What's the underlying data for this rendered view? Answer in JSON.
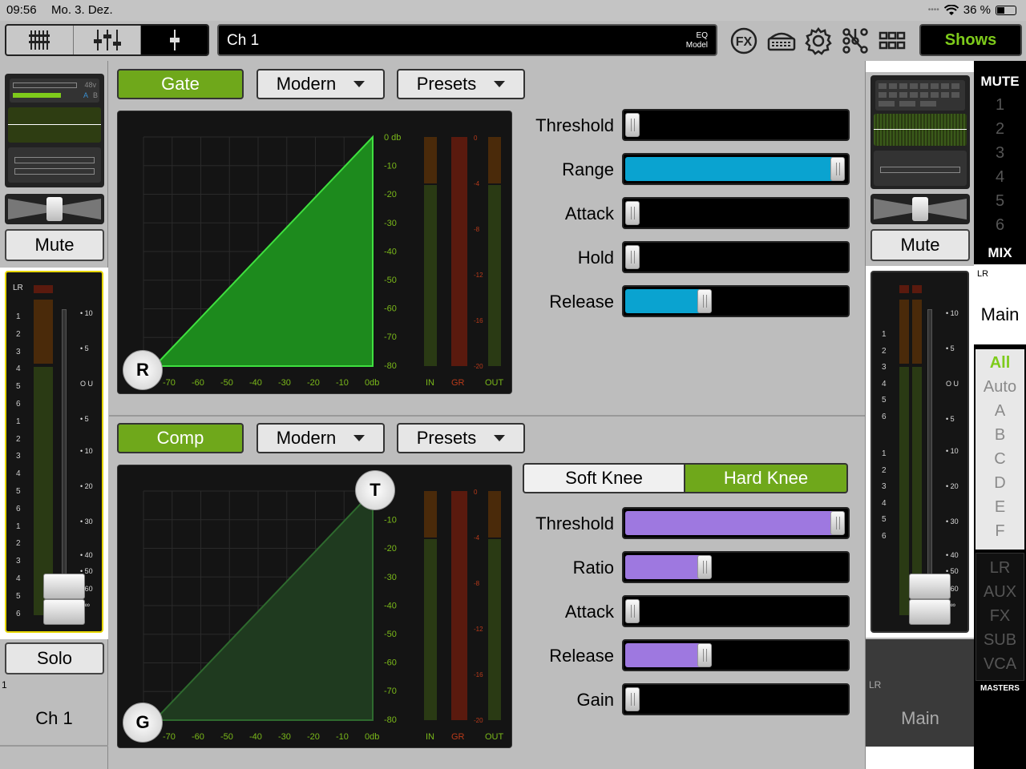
{
  "status": {
    "time": "09:56",
    "date": "Mo. 3. Dez.",
    "battery": "36 %",
    "battery_level": 0.36
  },
  "toolbar": {
    "channel_name": "Ch 1",
    "eq_label_1": "EQ",
    "eq_label_2": "Model",
    "fx_label": "FX",
    "shows_label": "Shows"
  },
  "left_strip": {
    "phantom": "48v",
    "ab_a": "A",
    "ab_b": "B",
    "mute_label": "Mute",
    "meter_lr": "LR",
    "solo_label": "Solo",
    "channel_number": "1",
    "channel_name": "Ch 1",
    "fader_scale": [
      "10",
      "5",
      "U",
      "5",
      "10",
      "20",
      "30",
      "40",
      "50",
      "60",
      "∞"
    ],
    "meter_rows": [
      "1",
      "2",
      "3",
      "4",
      "5",
      "6",
      "1",
      "2",
      "3",
      "4",
      "5",
      "6",
      "1",
      "2",
      "3",
      "4",
      "5",
      "6"
    ]
  },
  "gate": {
    "enable_label": "Gate",
    "model_label": "Modern",
    "presets_label": "Presets",
    "point_label": "R",
    "db_scale_y": [
      "0 db",
      "-10",
      "-20",
      "-30",
      "-40",
      "-50",
      "-60",
      "-70",
      "-80"
    ],
    "db_scale_x": [
      "-70",
      "-60",
      "-50",
      "-40",
      "-30",
      "-20",
      "-10",
      "0db"
    ],
    "meter_scale": [
      "0",
      "-4",
      "-8",
      "-12",
      "-16",
      "-20"
    ],
    "meter_in": "IN",
    "meter_gr": "GR",
    "meter_out": "OUT",
    "params": [
      {
        "label": "Threshold",
        "value": 0.0
      },
      {
        "label": "Range",
        "value": 1.0
      },
      {
        "label": "Attack",
        "value": 0.0
      },
      {
        "label": "Hold",
        "value": 0.0
      },
      {
        "label": "Release",
        "value": 0.35
      }
    ],
    "color": "#0aa3d0"
  },
  "comp": {
    "enable_label": "Comp",
    "model_label": "Modern",
    "presets_label": "Presets",
    "point_t_label": "T",
    "point_g_label": "G",
    "db_scale_y": [
      "db",
      "-10",
      "-20",
      "-30",
      "-40",
      "-50",
      "-60",
      "-70",
      "-80"
    ],
    "db_scale_x": [
      "-70",
      "-60",
      "-50",
      "-40",
      "-30",
      "-20",
      "-10",
      "0db"
    ],
    "meter_scale": [
      "0",
      "-4",
      "-8",
      "-12",
      "-16",
      "-20"
    ],
    "meter_in": "IN",
    "meter_gr": "GR",
    "meter_out": "OUT",
    "soft_knee_label": "Soft Knee",
    "hard_knee_label": "Hard Knee",
    "params": [
      {
        "label": "Threshold",
        "value": 1.0
      },
      {
        "label": "Ratio",
        "value": 0.35
      },
      {
        "label": "Attack",
        "value": 0.0
      },
      {
        "label": "Release",
        "value": 0.35
      },
      {
        "label": "Gain",
        "value": 0.0
      }
    ],
    "color": "#9e78e0"
  },
  "right_strip": {
    "mute_label": "Mute",
    "lr_label": "LR",
    "main_label": "Main",
    "fader_scale": [
      "10",
      "5",
      "U",
      "5",
      "10",
      "20",
      "30",
      "40",
      "50",
      "60",
      "∞"
    ],
    "meter_rows": [
      "1",
      "2",
      "3",
      "4",
      "5",
      "6",
      "1",
      "2",
      "3",
      "4",
      "5",
      "6"
    ]
  },
  "mute_groups": {
    "title": "MUTE",
    "items": [
      "1",
      "2",
      "3",
      "4",
      "5",
      "6"
    ]
  },
  "mix": {
    "title": "MIX",
    "lr": "LR",
    "main": "Main",
    "filters": [
      "All",
      "Auto",
      "A",
      "B",
      "C",
      "D",
      "E",
      "F"
    ],
    "masters": [
      "LR",
      "AUX",
      "FX",
      "SUB",
      "VCA"
    ],
    "masters_label": "MASTERS"
  }
}
